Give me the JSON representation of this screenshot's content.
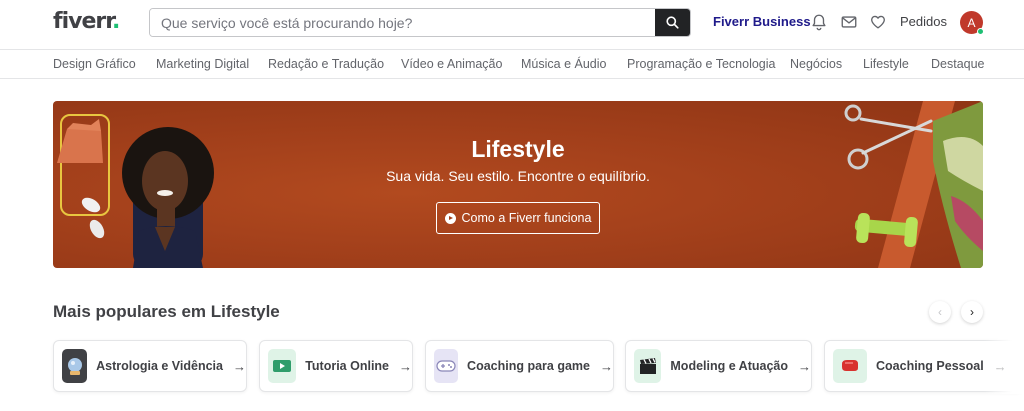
{
  "header": {
    "logo_text": "fiverr",
    "logo_dot": ".",
    "search_placeholder": "Que serviço você está procurando hoje?",
    "business_label": "Fiverr Business",
    "orders_label": "Pedidos",
    "avatar_initial": "A",
    "icons": [
      "bell-icon",
      "envelope-icon",
      "heart-icon",
      "search-icon"
    ]
  },
  "categories": [
    "Design Gráfico",
    "Marketing Digital",
    "Redação e Tradução",
    "Vídeo e Animação",
    "Música e Áudio",
    "Programação e Tecnologia",
    "Negócios",
    "Lifestyle",
    "Destaque"
  ],
  "banner": {
    "title": "Lifestyle",
    "subtitle": "Sua vida. Seu estilo. Encontre o equilíbrio.",
    "button_label": "Como a Fiverr funciona"
  },
  "popular": {
    "title": "Mais populares em Lifestyle",
    "items": [
      {
        "label": "Astrologia e Vidência",
        "icon": "crystal-ball-icon",
        "arrow": "→"
      },
      {
        "label": "Tutoria Online",
        "icon": "video-play-icon",
        "arrow": "→"
      },
      {
        "label": "Coaching para game",
        "icon": "gamepad-icon",
        "arrow": "→"
      },
      {
        "label": "Modeling e Atuação",
        "icon": "clapperboard-icon",
        "arrow": "→"
      },
      {
        "label": "Coaching Pessoal",
        "icon": "boxing-glove-icon",
        "arrow": "→"
      }
    ]
  },
  "colors": {
    "brand_green": "#1dbf73",
    "banner_bg": "#a3401b",
    "business_blue": "#1f1a8a",
    "avatar_red": "#c0392b"
  }
}
